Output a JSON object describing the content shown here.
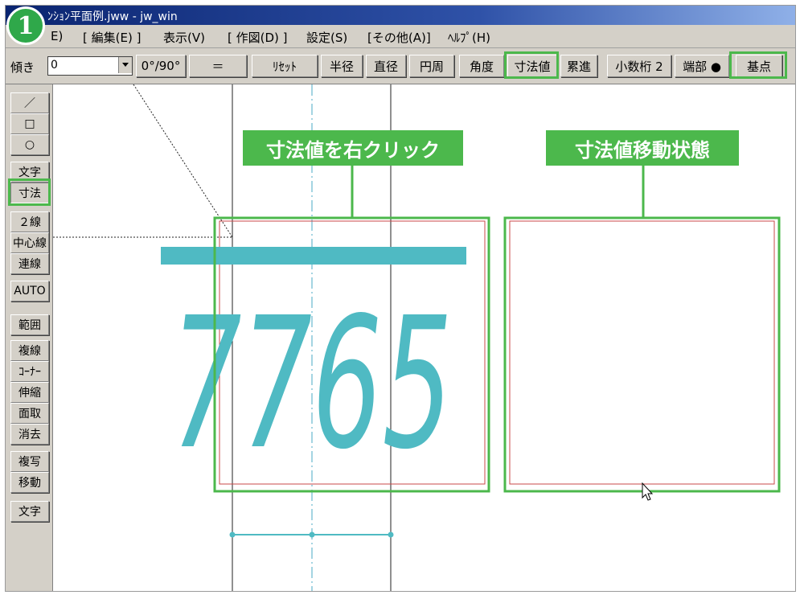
{
  "step_number": "1",
  "window": {
    "title": "ﾝｼｮﾝ平面例.jww - jw_win"
  },
  "menu": [
    {
      "label": "E)"
    },
    {
      "label": "[ 編集(E) ]"
    },
    {
      "label": "表示(V)"
    },
    {
      "label": "[ 作図(D) ]"
    },
    {
      "label": "設定(S)"
    },
    {
      "label": "[その他(A)]"
    },
    {
      "label": "ﾍﾙﾌﾟ(H)"
    }
  ],
  "toolbar": {
    "angle_label": "傾き",
    "angle_value": "0",
    "buttons": [
      {
        "label": "0°/90°"
      },
      {
        "label": "＝"
      },
      {
        "label": "ﾘｾｯﾄ"
      },
      {
        "label": "半径"
      },
      {
        "label": "直径"
      },
      {
        "label": "円周"
      },
      {
        "label": "角度"
      },
      {
        "label": "寸法値"
      },
      {
        "label": "累進"
      },
      {
        "label": "小数桁 2"
      },
      {
        "label": "端部 ●"
      },
      {
        "label": "基点"
      }
    ]
  },
  "tools": [
    {
      "label": "／"
    },
    {
      "label": "□"
    },
    {
      "label": "○"
    },
    {
      "label": "文字"
    },
    {
      "label": "寸法"
    },
    {
      "label": "２線"
    },
    {
      "label": "中心線"
    },
    {
      "label": "連線"
    },
    {
      "label": "AUTO"
    },
    {
      "label": "範囲"
    },
    {
      "label": "複線"
    },
    {
      "label": "ｺｰﾅｰ"
    },
    {
      "label": "伸縮"
    },
    {
      "label": "面取"
    },
    {
      "label": "消去"
    },
    {
      "label": "複写"
    },
    {
      "label": "移動"
    },
    {
      "label": "文字"
    }
  ],
  "drawing": {
    "dimension_text": "7765"
  },
  "callouts": {
    "left": "寸法値を右クリック",
    "right": "寸法値移動状態"
  },
  "colors": {
    "highlight_green": "#4cb84c",
    "dimension_teal": "#4fbac3",
    "wall_red": "#c84a4a",
    "window_blue": "#0a2470"
  }
}
